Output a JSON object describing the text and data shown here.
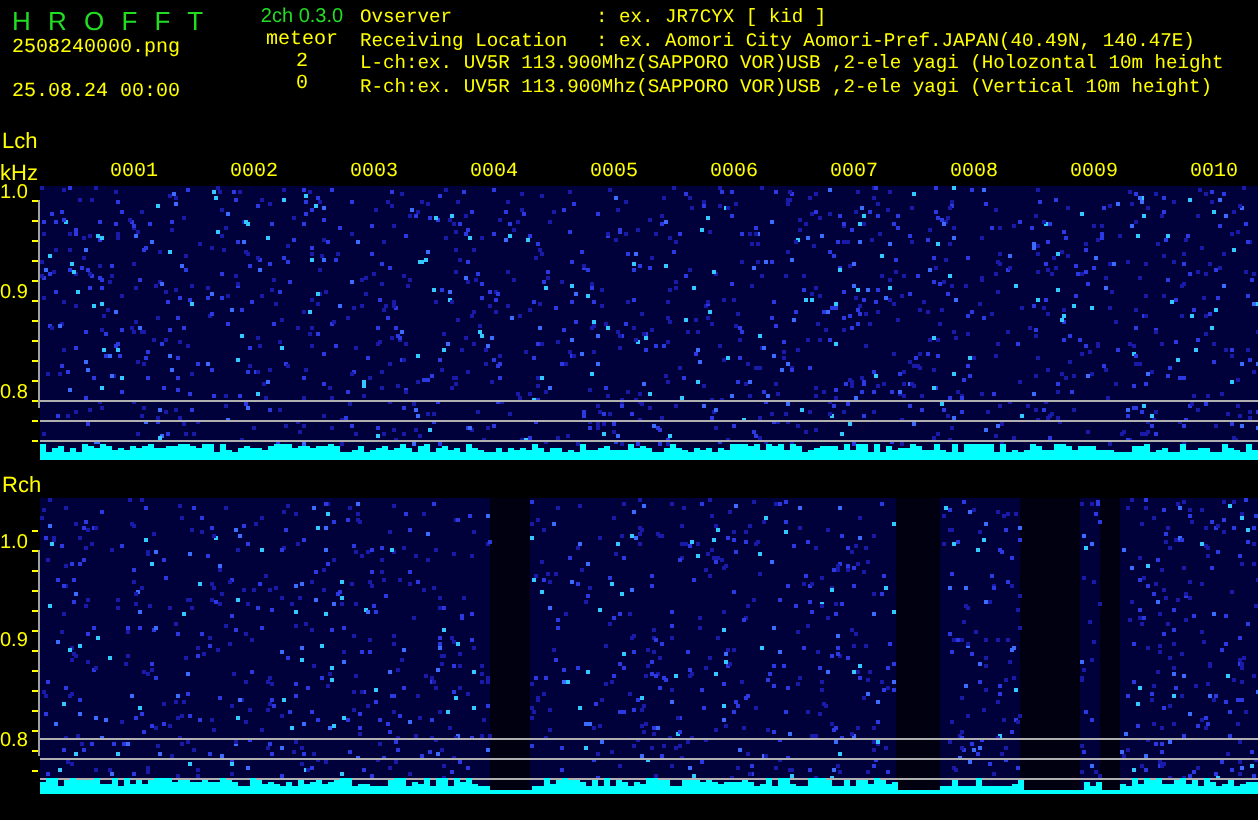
{
  "header": {
    "title": "H R O F F T",
    "version": "2ch 0.3.0",
    "mode": "meteor",
    "file": "2508240000.png",
    "datetime": "25.08.24 00:00",
    "counts": [
      "2",
      "0"
    ]
  },
  "info": [
    {
      "label": "Ovserver",
      "value": ": ex. JR7CYX [ kid ]"
    },
    {
      "label": "Receiving Location",
      "value": ": ex. Aomori City Aomori-Pref.JAPAN(40.49N, 140.47E)"
    },
    {
      "label": "L-ch:ex. UV5R 113.900Mhz(SAPPORO VOR)USB ,2-ele yagi (Holozontal 10m height"
    },
    {
      "label": "R-ch:ex. UV5R 113.900Mhz(SAPPORO VOR)USB ,2-ele yagi (Vertical 10m height)"
    }
  ],
  "time_labels": [
    "0001",
    "0002",
    "0003",
    "0004",
    "0005",
    "0006",
    "0007",
    "0008",
    "0009",
    "0010"
  ],
  "channels": [
    {
      "label": "Lch",
      "unit": "kHz",
      "ticks": [
        "1.0",
        "0.9",
        "0.8"
      ]
    },
    {
      "label": "Rch",
      "ticks": [
        "1.0",
        "0.9",
        "0.8"
      ]
    }
  ]
}
